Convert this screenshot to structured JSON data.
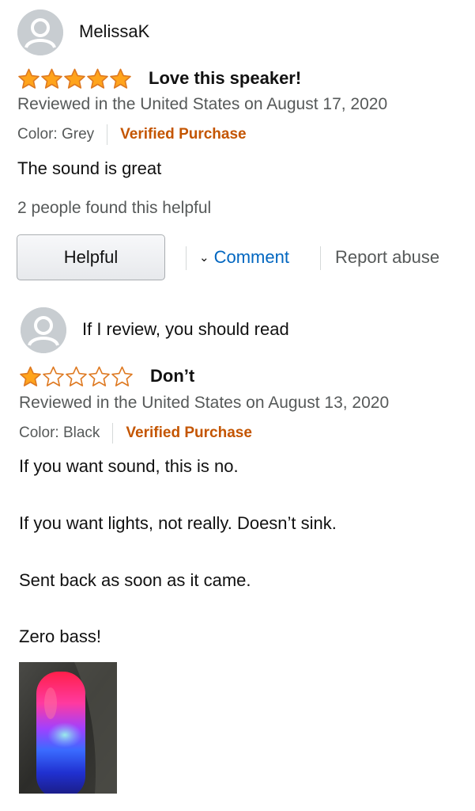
{
  "reviews": [
    {
      "author": "MelissaK",
      "rating": 5,
      "max_rating": 5,
      "title": "Love this speaker!",
      "date": "Reviewed in the United States on August 17, 2020",
      "color": "Color: Grey",
      "verified": "Verified Purchase",
      "body": [
        "The sound is great"
      ],
      "helpful_count": "2 people found this helpful",
      "actions": {
        "helpful_label": "Helpful",
        "comment_label": "Comment",
        "report_label": "Report abuse"
      }
    },
    {
      "author": "If I review, you should read",
      "rating": 1,
      "max_rating": 5,
      "title": "Don’t",
      "date": "Reviewed in the United States on August 13, 2020",
      "color": "Color: Black",
      "verified": "Verified Purchase",
      "body": [
        "If you want sound, this is no.",
        "If you want lights, not really. Doesn’t sink.",
        "Sent back as soon as it came.",
        "Zero bass!"
      ]
    }
  ],
  "colors": {
    "star": "#ffa41c",
    "star_outline": "#de7921",
    "verified": "#c45500",
    "link": "#0066c0",
    "secondary_text": "#565959"
  },
  "icons": {
    "avatar": "user-silhouette-icon",
    "chevron": "chevron-down-icon",
    "star": "star-icon"
  }
}
